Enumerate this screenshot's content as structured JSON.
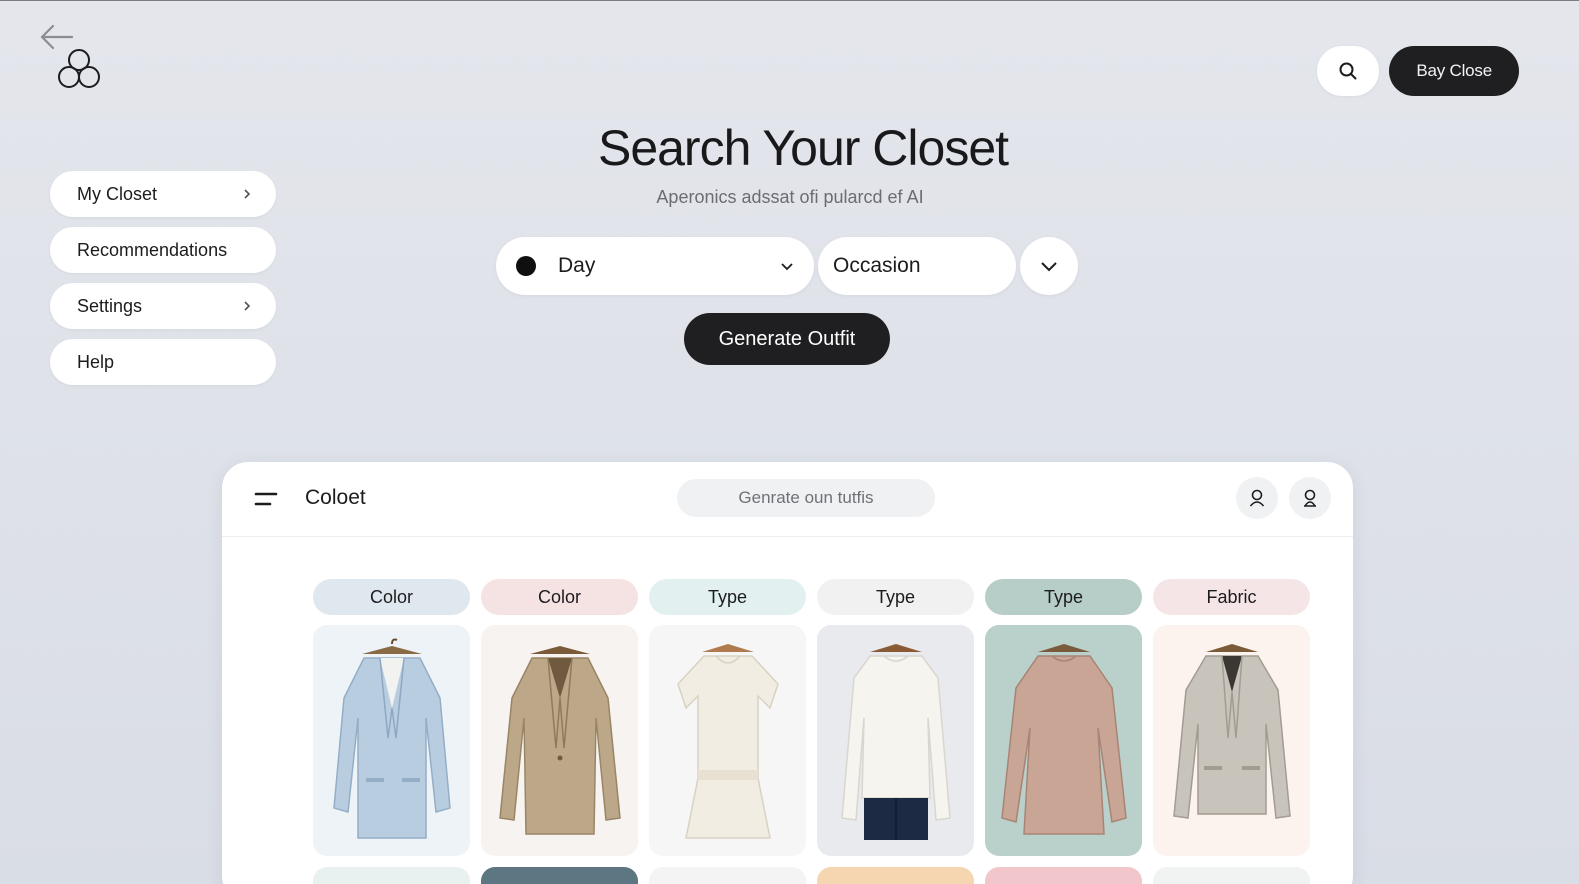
{
  "header": {
    "close_label": "Bay Close"
  },
  "sidebar": {
    "items": [
      {
        "label": "My Closet",
        "chevron": true
      },
      {
        "label": "Recommendations",
        "chevron": false
      },
      {
        "label": "Settings",
        "chevron": true
      },
      {
        "label": "Help",
        "chevron": false
      }
    ]
  },
  "hero": {
    "title": "Search Your Closet",
    "subtitle": "Aperonics adssat ofi pularcd ef AI"
  },
  "filters": {
    "day_value": "Day",
    "occasion_value": "Occasion"
  },
  "generate_label": "Generate Outfit",
  "panel": {
    "title": "Coloet",
    "search_placeholder": "Genrate oun tutfis",
    "columns": [
      {
        "chip": "Color",
        "chip_color": "#dfe7ef",
        "card_color": "#eef3f7",
        "item": "light blue blazer"
      },
      {
        "chip": "Color",
        "chip_color": "#f5e3e3",
        "card_color": "#f7f3f1",
        "item": "tan blazer"
      },
      {
        "chip": "Type",
        "chip_color": "#e3f0f0",
        "card_color": "#f6f6f6",
        "item": "cream dress"
      },
      {
        "chip": "Type",
        "chip_color": "#f1f1f1",
        "card_color": "#e9eaee",
        "item": "white long sleeve top"
      },
      {
        "chip": "Type",
        "chip_color": "#b7cec8",
        "card_color": "#b9d0cb",
        "item": "pink sweater"
      },
      {
        "chip": "Fabric",
        "chip_color": "#f6e5e7",
        "card_color": "#fcf3ee",
        "item": "grey striped blazer"
      }
    ],
    "next_row_colors": [
      "#e9f1f0",
      "#5d7682",
      "#f4f4f4",
      "#f6d6b1",
      "#f1c7cc",
      "#f1f3f3"
    ]
  }
}
